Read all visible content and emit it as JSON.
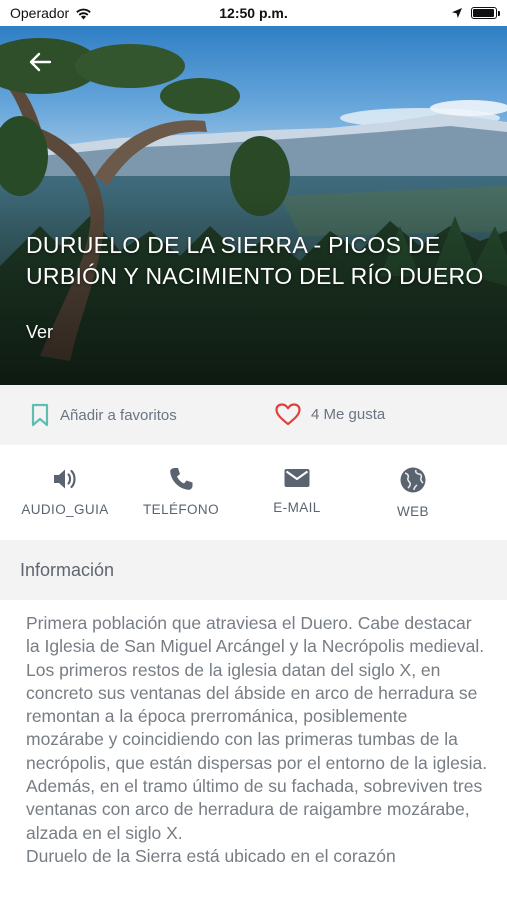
{
  "status_bar": {
    "carrier": "Operador",
    "time": "12:50 p.m.",
    "battery_level": 0.95
  },
  "hero": {
    "title": "DURUELO DE LA SIERRA - PICOS DE URBIÓN Y NACIMIENTO DEL RÍO DUERO",
    "subtitle": "Ver",
    "back_icon": "arrow-left-icon"
  },
  "favorites": {
    "bookmark_label": "Añadir a favoritos",
    "bookmark_icon": "bookmark-icon",
    "like_label": "4 Me gusta",
    "like_icon": "heart-icon",
    "bookmark_color": "#5fbdb3",
    "heart_color": "#e0403c"
  },
  "actions": [
    {
      "label": "AUDIO_GUIA",
      "icon": "speaker-icon"
    },
    {
      "label": "TELÉFONO",
      "icon": "phone-icon"
    },
    {
      "label": "E-MAIL",
      "icon": "mail-icon"
    },
    {
      "label": "WEB",
      "icon": "globe-icon"
    }
  ],
  "info": {
    "header": "Información",
    "description": "Primera población que atraviesa el Duero. Cabe destacar la  Iglesia de San Miguel Arcángel  y la Necrópolis medieval. Los primeros restos de la iglesia datan del siglo X, en concreto sus ventanas del ábside en arco de herradura se remontan a la época prerrománica, posiblemente mozárabe y coincidiendo con las primeras tumbas de la necrópolis, que están dispersas por el entorno de la iglesia. Además, en el tramo último de su fachada, sobreviven tres ventanas con arco de herradura de raigambre mozárabe, alzada en el siglo X.\nDuruelo de la Sierra está ubicado  en el corazón"
  }
}
